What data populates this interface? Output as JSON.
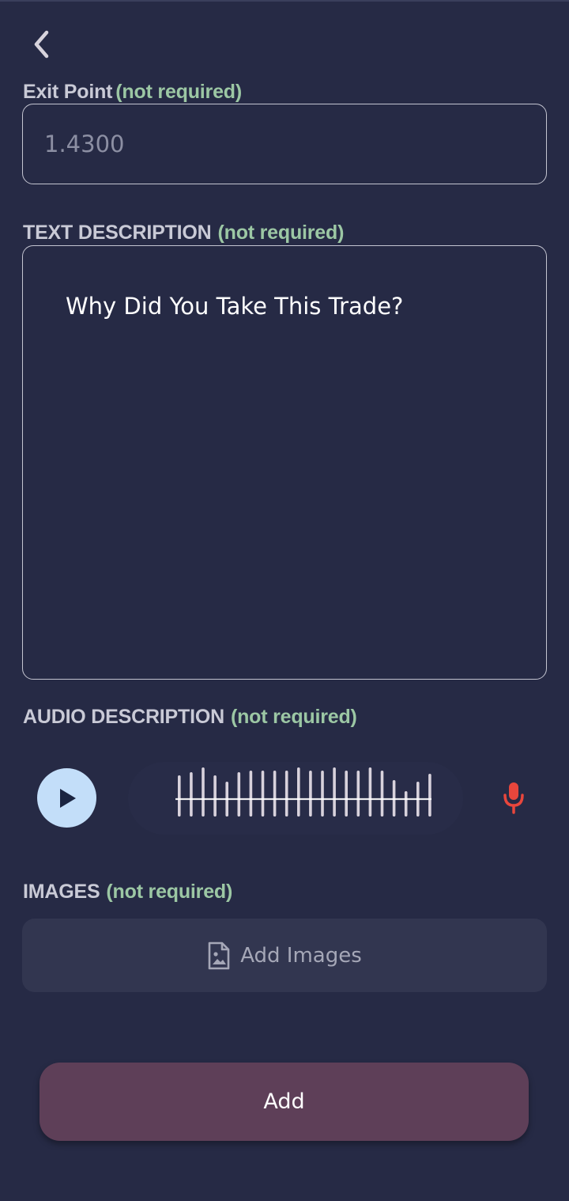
{
  "exit_point": {
    "label": "Exit Point",
    "note": "(not required)",
    "placeholder": "1.4300"
  },
  "text_description": {
    "label": "TEXT DESCRIPTION",
    "note": "(not required)",
    "placeholder": "Why Did You Take This Trade?"
  },
  "audio_description": {
    "label": "AUDIO DESCRIPTION",
    "note": "(not required)"
  },
  "images": {
    "label": "IMAGES",
    "note": "(not required)",
    "add_label": "Add Images"
  },
  "submit": {
    "label": "Add"
  },
  "colors": {
    "background": "#262a45",
    "note_green": "#9cc7a4",
    "play_button": "#c3def9",
    "mic_red": "#e8463c",
    "submit_button": "#5e3f58",
    "wave_bar": "#d8d2dc"
  },
  "icons": {
    "back": "chevron-left-icon",
    "play": "play-icon",
    "mic": "microphone-icon",
    "image_file": "image-file-icon"
  }
}
